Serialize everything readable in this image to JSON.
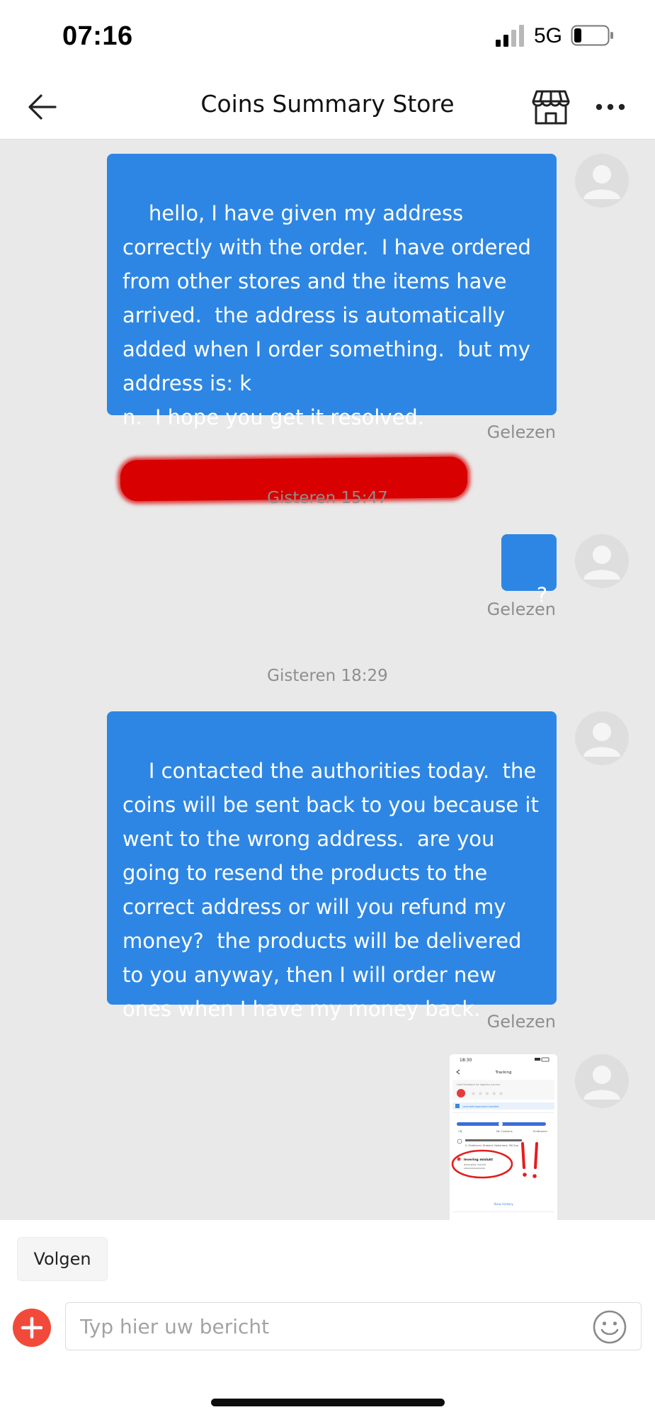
{
  "status_bar": {
    "time": "07:16",
    "network": "5G"
  },
  "header": {
    "title": "Coins Summary Store"
  },
  "messages": [
    {
      "text": "hello, I have given my address correctly with the order.  I have ordered from other stores and the items have arrived.  the address is automatically added when I order something.  but my address is: k                                          n.  I hope you get it resolved.",
      "status": "Gelezen"
    },
    {
      "timestamp": "Gisteren 15:47",
      "text": "?",
      "status": "Gelezen"
    },
    {
      "timestamp": "Gisteren 18:29",
      "text": "I contacted the authorities today.  the coins will be sent back to you because it went to the wrong address.  are you going to resend the products to the correct address or will you refund my money?  the products will be delivered to you anyway, then I will order new ones when I have my money back.",
      "status": "Gelezen"
    }
  ],
  "thumbnail": {
    "time": "18:30",
    "title": "Tracking",
    "rating_prompt": "Geef Feedback for logistics service",
    "banner": "Leverdatumgarantie kwaliteit",
    "steps": [
      "CN",
      "NL Customs",
      "Eindhoven"
    ],
    "address": "5, Eindhoven, Brabant, Nederland, 5611ap",
    "event_title": "levering mislukt",
    "event_sub": "bezorging mislukt",
    "link": "View history"
  },
  "composer": {
    "follow_label": "Volgen",
    "placeholder": "Typ hier uw bericht"
  },
  "colors": {
    "bubble": "#2e86e4",
    "accent_red": "#f24a3a",
    "redaction": "#d80000"
  },
  "icons": [
    "signal-icon",
    "battery-icon",
    "back-arrow-icon",
    "store-icon",
    "more-icon",
    "avatar-icon",
    "plus-icon",
    "emoji-icon"
  ]
}
